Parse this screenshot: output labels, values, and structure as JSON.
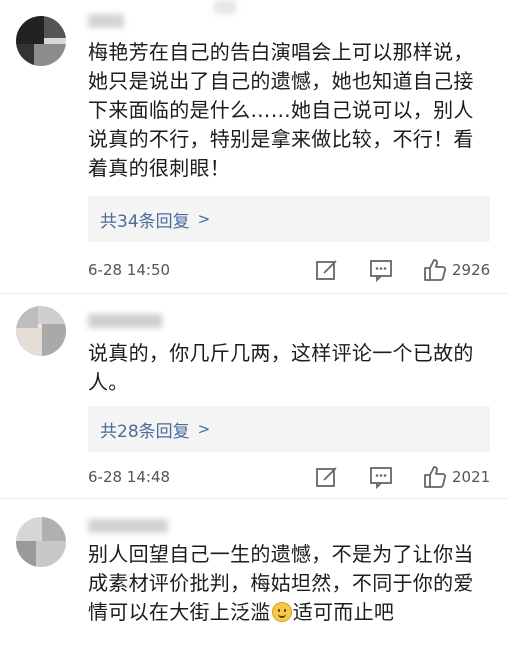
{
  "comments": [
    {
      "username": "",
      "text": "梅艳芳在自己的告白演唱会上可以那样说，她只是说出了自己的遗憾，她也知道自己接下来面临的是什么……她自己说可以，别人说真的不行，特别是拿来做比较，不行！看着真的很刺眼！",
      "replies": "共34条回复",
      "time": "6-28 14:50",
      "likes": "2926"
    },
    {
      "username": "",
      "text": "说真的，你几斤几两，这样评论一个已故的人。",
      "replies": "共28条回复",
      "time": "6-28 14:48",
      "likes": "2021"
    },
    {
      "username": "",
      "text_before": "别人回望自己一生的遗憾，不是为了让你当成素材评价批判，梅姑坦然，不同于你的爱情可以在大街上泛滥",
      "emoji": "smiley-emoji",
      "text_after": "适可而止吧"
    }
  ],
  "icons": {
    "chevron": "chevron-right-icon",
    "edit": "edit-icon",
    "comment": "comment-icon",
    "like": "thumbs-up-icon"
  },
  "colors": {
    "link": "#4a6c9b",
    "reply_bg": "#f4f4f4",
    "meta_text": "#555555"
  }
}
